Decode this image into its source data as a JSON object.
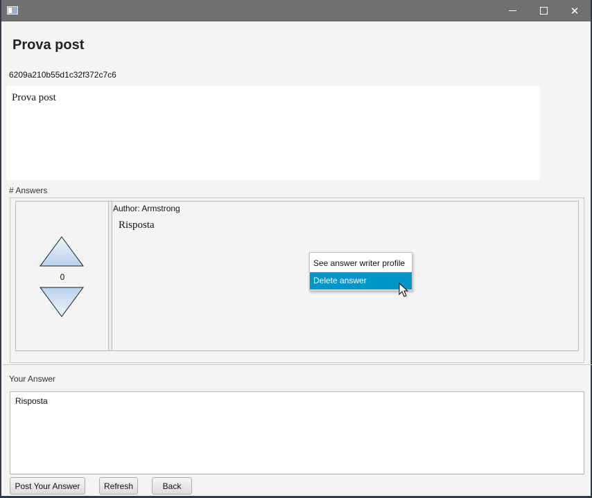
{
  "window": {
    "app_icon": "window-icon",
    "controls": {
      "minimize_icon": "minimize-icon",
      "maximize_icon": "maximize-icon",
      "close_icon": "close-icon",
      "close_glyph": "✕"
    }
  },
  "post": {
    "title": "Prova post",
    "id": "6209a210b55d1c32f372c7c6",
    "body": "Prova post"
  },
  "answers": {
    "label": "# Answers",
    "items": [
      {
        "votes": "0",
        "author": "Author: Armstrong",
        "text": "Risposta",
        "upvote_icon": "triangle-up-icon",
        "downvote_icon": "triangle-down-icon"
      }
    ]
  },
  "context_menu": {
    "items": [
      {
        "label": "See answer writer profile",
        "active": false
      },
      {
        "label": "Delete answer",
        "active": true
      }
    ],
    "highlight_color": "#0096c9"
  },
  "your_answer": {
    "label": "Your Answer",
    "value": "Risposta"
  },
  "buttons": {
    "post": "Post Your Answer",
    "refresh": "Refresh",
    "back": "Back"
  },
  "colors": {
    "titlebar": "#707070",
    "background": "#f4f4f4",
    "triangle_fill_top": "#eef4fb",
    "triangle_fill_bottom": "#b9d3ee"
  }
}
